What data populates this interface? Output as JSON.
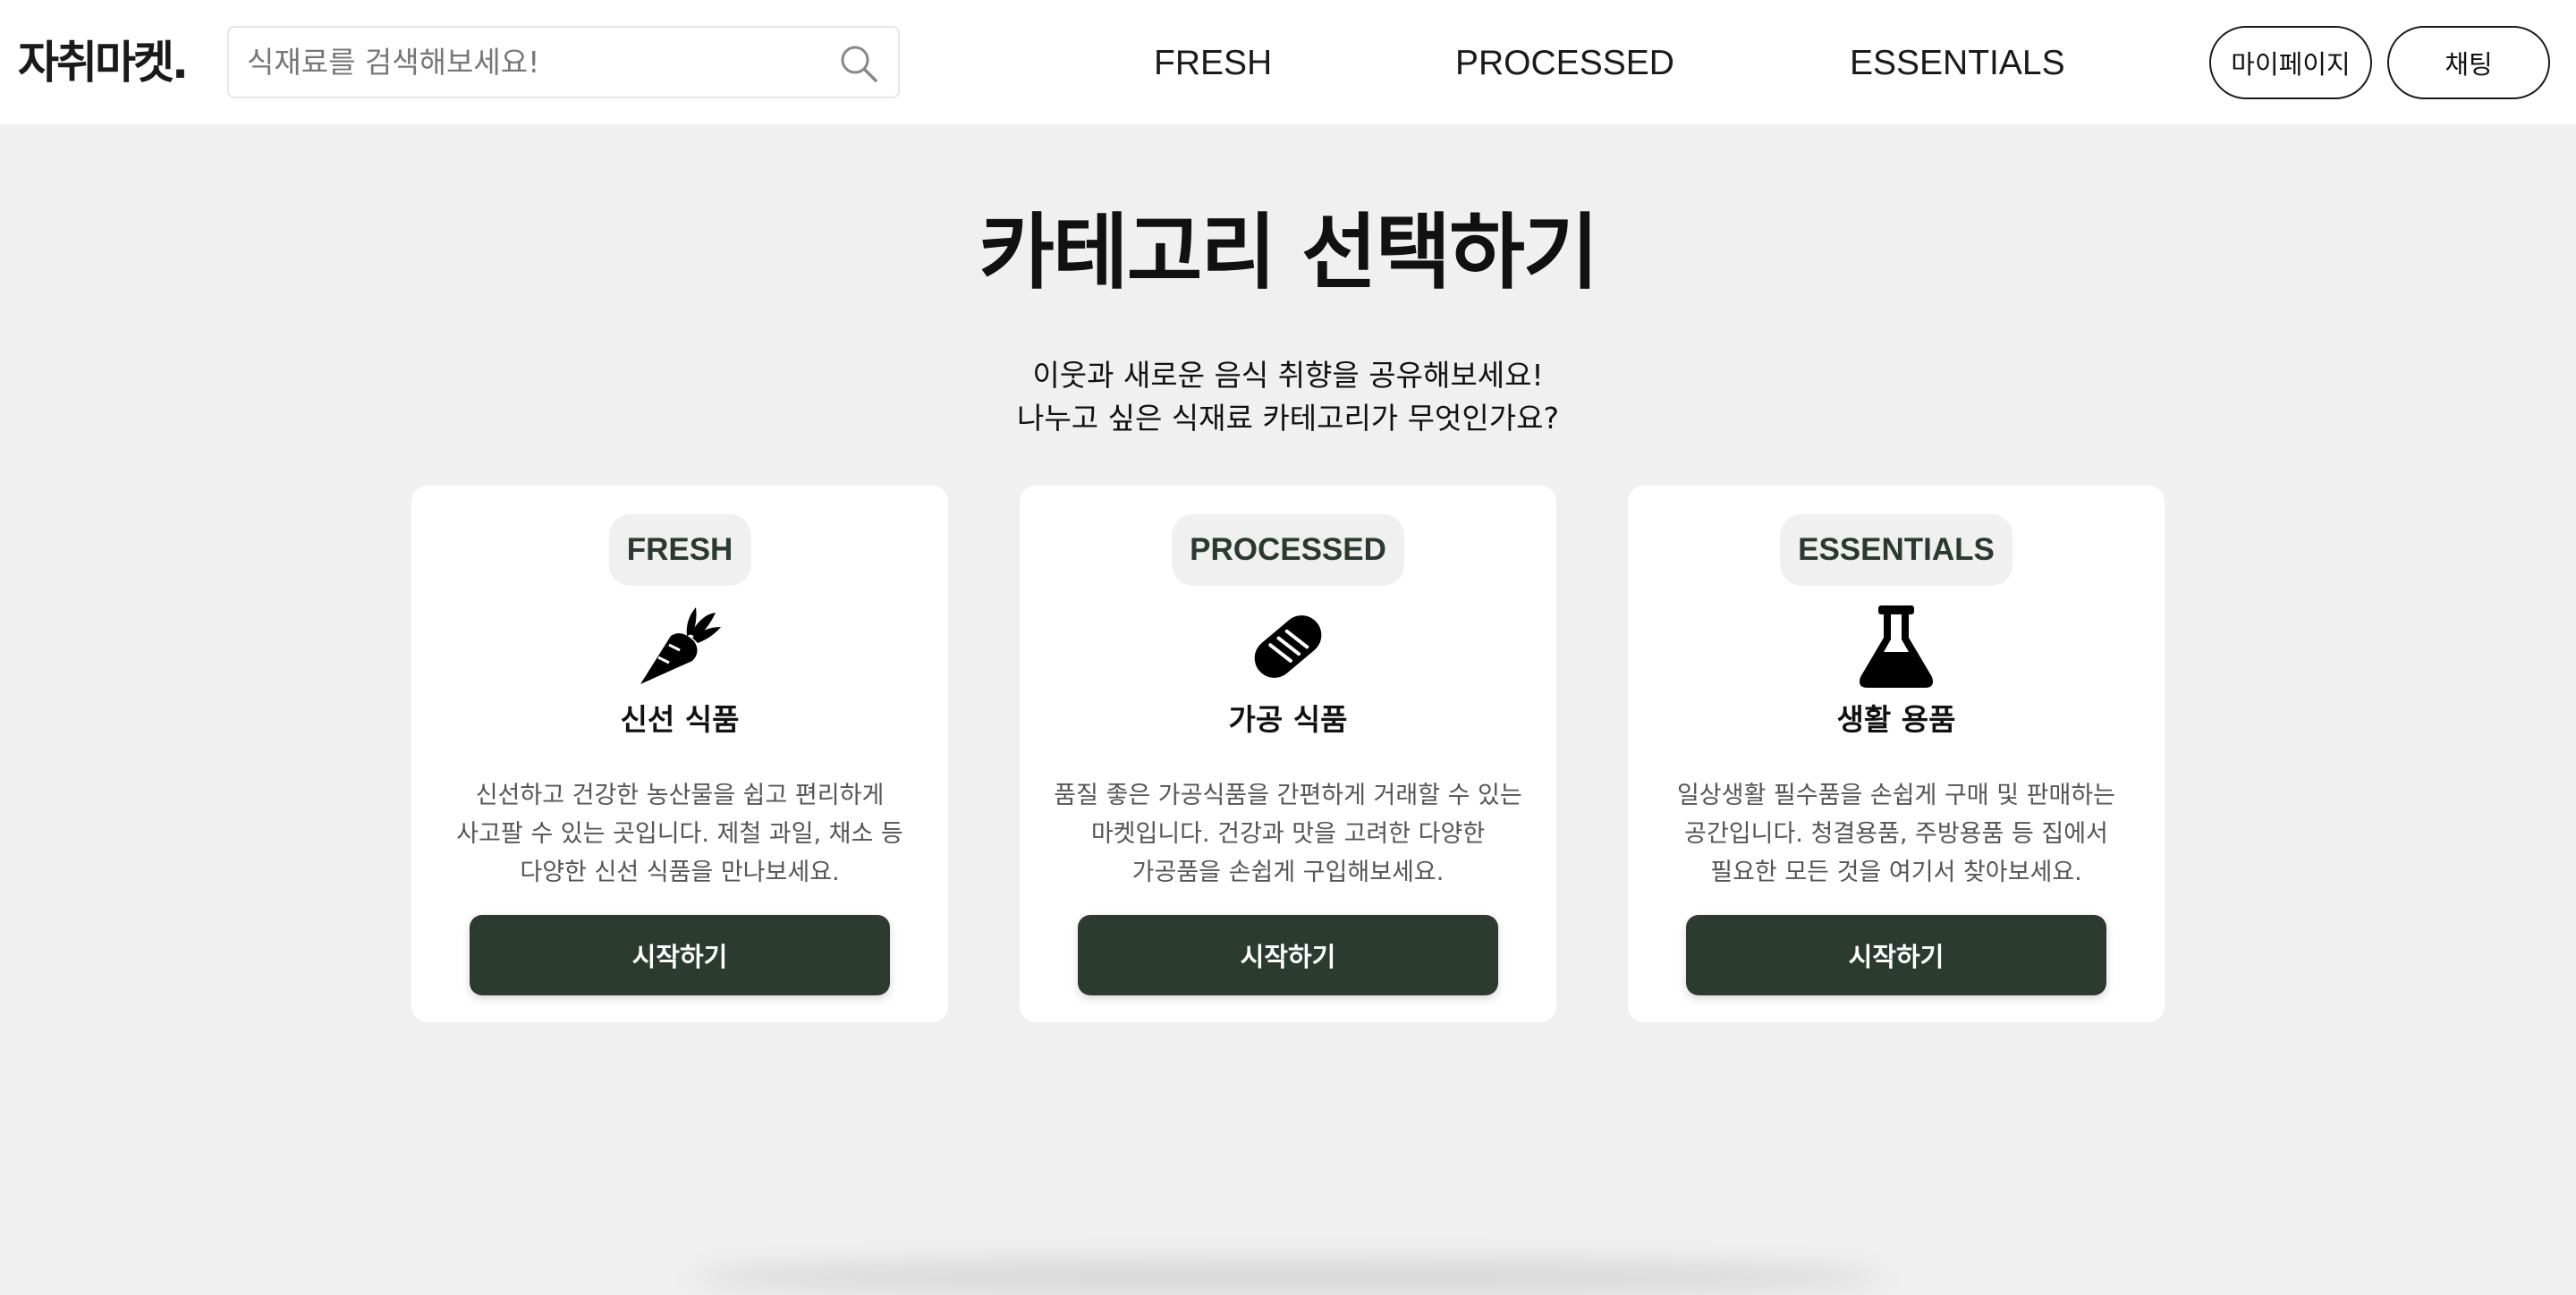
{
  "header": {
    "logo": "자취마켓.",
    "search": {
      "placeholder": "식재료를 검색해보세요!",
      "value": ""
    },
    "nav": [
      "FRESH",
      "PROCESSED",
      "ESSENTIALS"
    ],
    "mypage_label": "마이페이지",
    "chat_label": "채팅"
  },
  "main": {
    "title": "카테고리 선택하기",
    "subtitle_line1": "이웃과 새로운 음식 취향을 공유해보세요!",
    "subtitle_line2": "나누고 싶은 식재료 카테고리가 무엇인가요?",
    "cards": [
      {
        "badge": "FRESH",
        "icon": "carrot-icon",
        "name": "신선 식품",
        "description": "신선하고 건강한 농산물을 쉽고 편리하게 사고팔 수 있는 곳입니다. 제철 과일, 채소 등 다양한 신선 식품을 만나보세요.",
        "button": "시작하기"
      },
      {
        "badge": "PROCESSED",
        "icon": "bread-icon",
        "name": "가공 식품",
        "description": "품질 좋은 가공식품을 간편하게 거래할 수 있는 마켓입니다. 건강과 맛을 고려한 다양한 가공품을 손쉽게 구입해보세요.",
        "button": "시작하기"
      },
      {
        "badge": "ESSENTIALS",
        "icon": "flask-icon",
        "name": "생활 용품",
        "description": "일상생활 필수품을 손쉽게 구매 및 판매하는 공간입니다. 청결용품, 주방용품 등 집에서 필요한 모든 것을 여기서 찾아보세요.",
        "button": "시작하기"
      }
    ]
  },
  "colors": {
    "page_bg": "#f0f0f0",
    "header_bg": "#ffffff",
    "accent_button": "#2b3b30",
    "badge_bg": "#f0f0f0",
    "badge_text": "#2b3a2f"
  }
}
